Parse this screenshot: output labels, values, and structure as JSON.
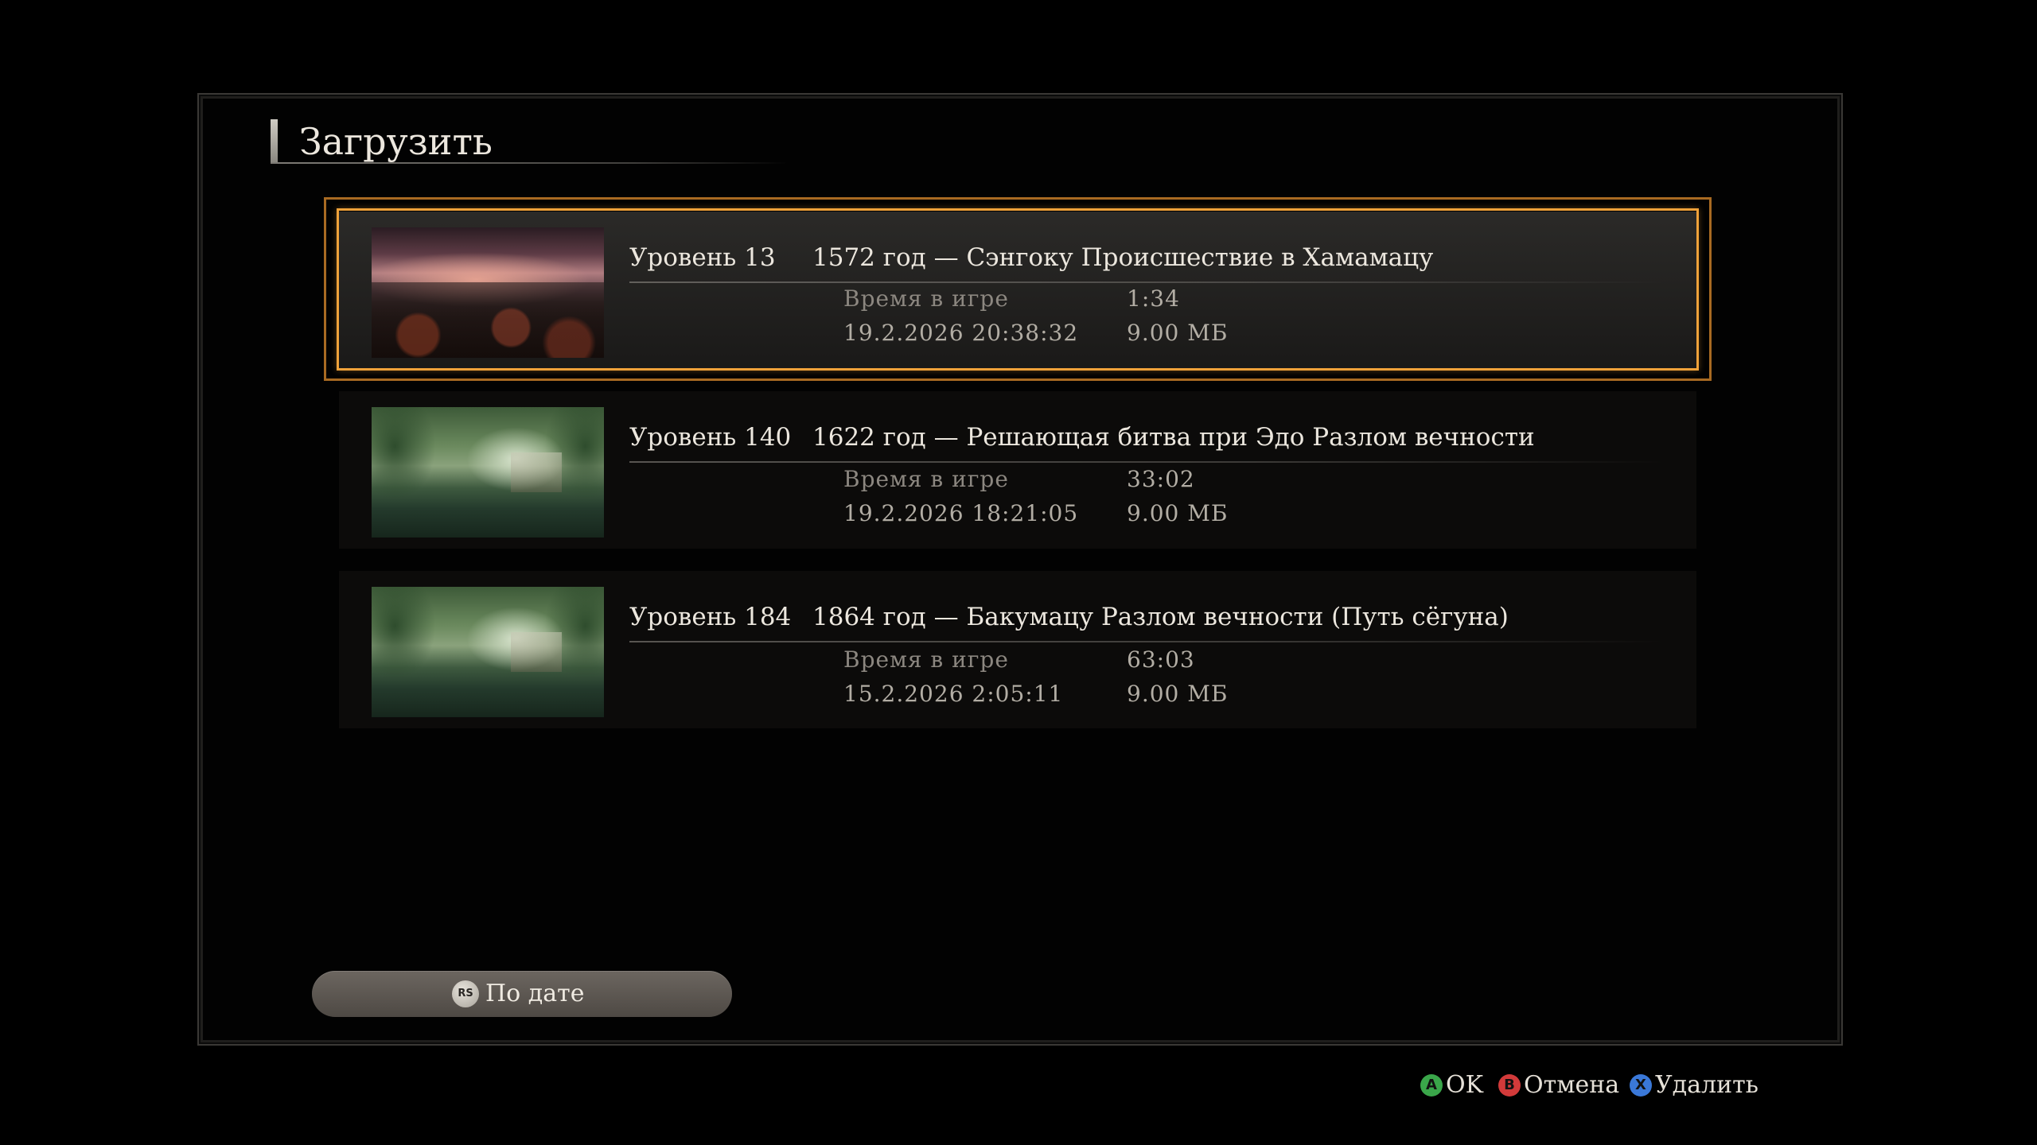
{
  "dialog": {
    "title": "Загрузить"
  },
  "saves": [
    {
      "level": "Уровень 13",
      "chapter": "1572 год — Сэнгоку Происшествие в Хамамацу",
      "playtime_label": "Время в игре",
      "playtime": "1:34",
      "timestamp": "19.2.2026 20:38:32",
      "size": "9.00 МБ",
      "thumbnail": "sunset-landscape",
      "selected": true
    },
    {
      "level": "Уровень 140",
      "chapter": "1622 год — Решающая битва при Эдо Разлом вечности",
      "playtime_label": "Время в игре",
      "playtime": "33:02",
      "timestamp": "19.2.2026 18:21:05",
      "size": "9.00 МБ",
      "thumbnail": "forest-shrine",
      "selected": false
    },
    {
      "level": "Уровень 184",
      "chapter": "1864 год — Бакумацу Разлом вечности (Путь сёгуна)",
      "playtime_label": "Время в игре",
      "playtime": "63:03",
      "timestamp": "15.2.2026 2:05:11",
      "size": "9.00 МБ",
      "thumbnail": "forest-shrine",
      "selected": false
    }
  ],
  "sort": {
    "icon": "RS",
    "label": "По дате"
  },
  "hints": [
    {
      "button": "A",
      "label": "OK",
      "color": "#3aa64a"
    },
    {
      "button": "B",
      "label": "Отмена",
      "color": "#d23a3a"
    },
    {
      "button": "X",
      "label": "Удалить",
      "color": "#3a78d8"
    }
  ],
  "colors": {
    "selection_outer": "#a86a22",
    "selection_inner": "#f0a23a",
    "background": "#000000"
  }
}
